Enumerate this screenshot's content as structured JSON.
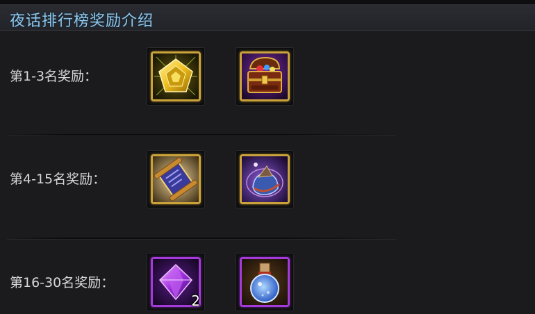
{
  "title": "夜话排行榜奖励介绍",
  "rows": [
    {
      "label": "第1-3名奖励：",
      "items": [
        {
          "icon": "gold-pentagon-emblem-icon",
          "frame": "gold",
          "count": ""
        },
        {
          "icon": "treasure-chest-icon",
          "frame": "gold",
          "count": ""
        }
      ]
    },
    {
      "label": "第4-15名奖励：",
      "items": [
        {
          "icon": "magic-scroll-icon",
          "frame": "gold",
          "count": ""
        },
        {
          "icon": "magic-pouch-icon",
          "frame": "gold",
          "count": ""
        }
      ]
    },
    {
      "label": "第16-30名奖励：",
      "items": [
        {
          "icon": "purple-gem-icon",
          "frame": "purple",
          "count": "2"
        },
        {
          "icon": "blue-potion-bottle-icon",
          "frame": "purple",
          "count": ""
        }
      ]
    }
  ],
  "colors": {
    "title": "#8fc6ea",
    "gold_frame": "#c9a23c",
    "purple_frame": "#a43ad8"
  }
}
